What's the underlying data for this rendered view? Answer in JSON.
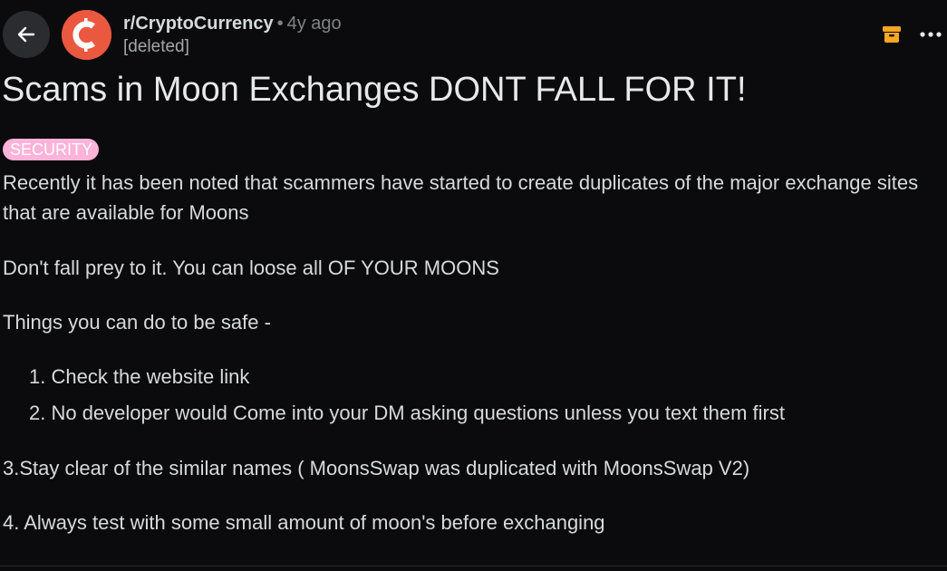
{
  "header": {
    "back_icon": "arrow-left-icon",
    "subreddit": "r/CryptoCurrency",
    "separator": "•",
    "time": "4y ago",
    "author": "[deleted]",
    "archive_icon": "archive-box-icon",
    "more_icon": "more-horizontal-icon",
    "accent_color": "#e9583f",
    "archive_color": "#f5a623"
  },
  "post": {
    "title": "Scams in Moon Exchanges DONT FALL FOR IT!",
    "flair": "SECURITY",
    "flair_color": "#ffb3d9",
    "paragraphs": [
      "Recently it has been noted that scammers have started to create duplicates of the major exchange sites that are available for Moons",
      "Don't fall prey to it. You can loose all OF YOUR MOONS",
      "Things you can do to be safe -"
    ],
    "list_items": [
      "1. Check the website link",
      "2. No developer would Come into your DM asking questions unless you text them first"
    ],
    "after_list": [
      "3.Stay clear of the similar names ( MoonsSwap was duplicated with MoonsSwap V2)",
      "4. Always test with some small amount of moon's before exchanging"
    ]
  }
}
